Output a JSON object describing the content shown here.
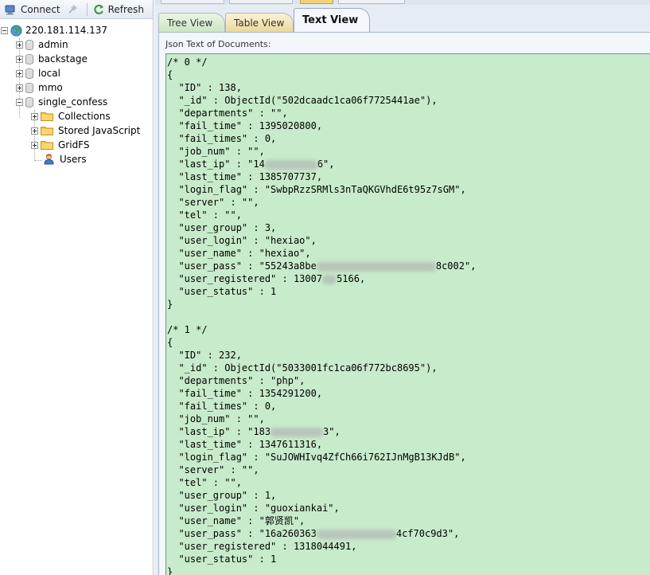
{
  "toolbar": {
    "connect_label": "Connect",
    "refresh_label": "Refresh"
  },
  "tree": {
    "server": "220.181.114.137",
    "databases": [
      "admin",
      "backstage",
      "local",
      "mmo",
      "single_confess"
    ],
    "children": [
      "Collections",
      "Stored JavaScript",
      "GridFS",
      "Users"
    ]
  },
  "tabs": {
    "tree": "Tree View",
    "table": "Table View",
    "text": "Text View"
  },
  "panel": {
    "label": "Json Text of Documents:"
  },
  "documents": [
    {
      "header": "/* 0 */",
      "open": "{",
      "fields": [
        "  \"ID\" : 138,",
        "  \"_id\" : ObjectId(\"502dcaadc1ca06f7725441ae\"),",
        "  \"departments\" : \"\",",
        "  \"fail_time\" : 1395020800,",
        "  \"fail_times\" : 0,",
        "  \"job_num\" : \"\","
      ],
      "last_ip_pre": "  \"last_ip\" : \"14",
      "last_ip_post": "6\",",
      "fields2": [
        "  \"last_time\" : 1385707737,",
        "  \"login_flag\" : \"SwbpRzzSRMls3nTaQKGVhdE6t95z7sGM\",",
        "  \"server\" : \"\",",
        "  \"tel\" : \"\",",
        "  \"user_group\" : 3,",
        "  \"user_login\" : \"hexiao\",",
        "  \"user_name\" : \"hexiao\","
      ],
      "user_pass_pre": "  \"user_pass\" : \"55243a8be",
      "user_pass_post": "8c002\",",
      "registered_pre": "  \"user_registered\" : 13007",
      "registered_post": "5166,",
      "fields3": [
        "  \"user_status\" : 1"
      ],
      "close": "}"
    },
    {
      "header": "/* 1 */",
      "open": "{",
      "fields": [
        "  \"ID\" : 232,",
        "  \"_id\" : ObjectId(\"5033001fc1ca06f772bc8695\"),",
        "  \"departments\" : \"php\",",
        "  \"fail_time\" : 1354291200,",
        "  \"fail_times\" : 0,",
        "  \"job_num\" : \"\","
      ],
      "last_ip_pre": "  \"last_ip\" : \"183",
      "last_ip_post": "3\",",
      "fields2": [
        "  \"last_time\" : 1347611316,",
        "  \"login_flag\" : \"SuJOWHIvq4ZfCh66i762IJnMgB13KJdB\",",
        "  \"server\" : \"\",",
        "  \"tel\" : \"\",",
        "  \"user_group\" : 1,",
        "  \"user_login\" : \"guoxiankai\",",
        "  \"user_name\" : \"郭贤凯\","
      ],
      "user_pass_pre": "  \"user_pass\" : \"16a260363",
      "user_pass_post": "4cf70c9d3\",",
      "registered_pre": "  \"user_registered\" : 1318044491,",
      "registered_post": "",
      "fields3": [
        "  \"user_status\" : 1"
      ],
      "close": "}"
    }
  ]
}
